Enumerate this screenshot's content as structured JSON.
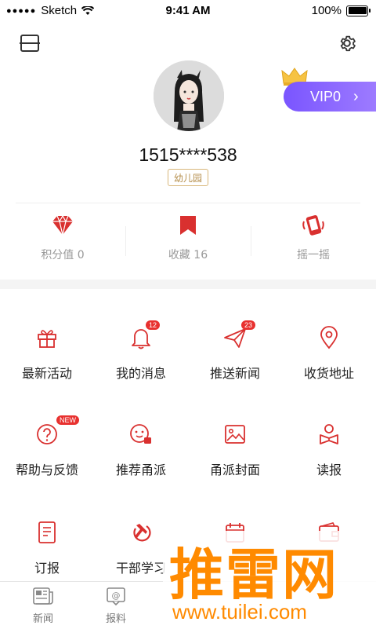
{
  "status_bar": {
    "carrier": "Sketch",
    "time": "9:41 AM",
    "battery": "100%"
  },
  "profile": {
    "phone": "1515****538",
    "tag": "幼儿园",
    "vip_label": "VIP0"
  },
  "stats": [
    {
      "label": "积分值 0",
      "icon": "diamond-icon"
    },
    {
      "label": "收藏 16",
      "icon": "bookmark-icon"
    },
    {
      "label": "摇一摇",
      "icon": "shake-phone-icon"
    }
  ],
  "menu": [
    {
      "label": "最新活动",
      "icon": "gift-icon"
    },
    {
      "label": "我的消息",
      "icon": "bell-icon",
      "badge": "12"
    },
    {
      "label": "推送新闻",
      "icon": "paper-plane-icon",
      "badge": "23"
    },
    {
      "label": "收货地址",
      "icon": "location-pin-icon"
    },
    {
      "label": "帮助与反馈",
      "icon": "help-icon",
      "badge": "NEW"
    },
    {
      "label": "推荐甬派",
      "icon": "recommend-icon"
    },
    {
      "label": "甬派封面",
      "icon": "image-icon"
    },
    {
      "label": "读报",
      "icon": "reader-icon"
    },
    {
      "label": "订报",
      "icon": "subscribe-icon"
    },
    {
      "label": "干部学习",
      "icon": "hammer-sickle-icon"
    }
  ],
  "tabs": [
    {
      "label": "新闻",
      "icon": "newspaper-icon"
    },
    {
      "label": "报料",
      "icon": "at-chat-icon"
    }
  ],
  "watermark": {
    "big": "推雷网",
    "small": "www.tuilei.com"
  },
  "colors": {
    "accent": "#d9302f",
    "vip": "#8563ff",
    "watermark": "#ff8a00"
  }
}
